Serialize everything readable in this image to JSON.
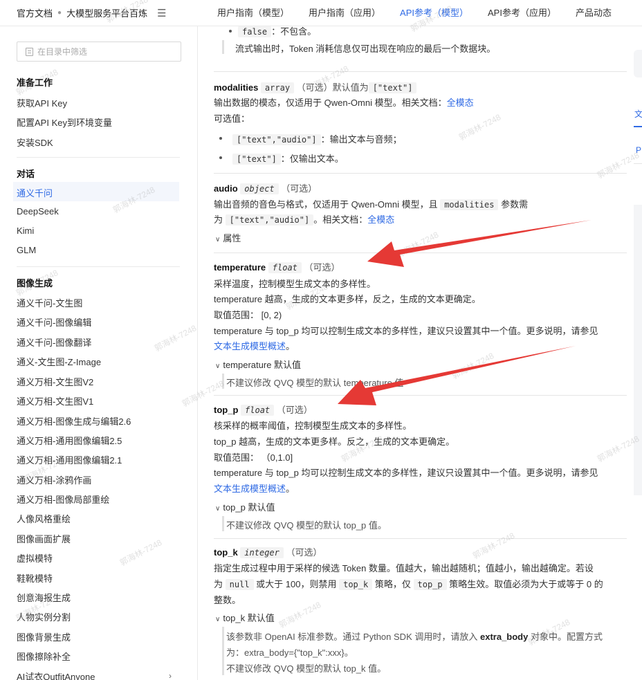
{
  "header": {
    "brand": "官方文档",
    "product": "大模型服务平台百炼",
    "menu_icon": "hamburger-icon",
    "tabs": [
      {
        "label": "用户指南（模型）",
        "active": false
      },
      {
        "label": "用户指南（应用）",
        "active": false
      },
      {
        "label": "API参考（模型）",
        "active": true
      },
      {
        "label": "API参考（应用）",
        "active": false
      },
      {
        "label": "产品动态",
        "active": false
      }
    ]
  },
  "sidebar": {
    "filter_placeholder": "在目录中筛选",
    "groups": [
      {
        "title": "准备工作",
        "items": [
          "获取API Key",
          "配置API Key到环境变量",
          "安装SDK"
        ]
      },
      {
        "title": "对话",
        "items": [
          "通义千问",
          "DeepSeek",
          "Kimi",
          "GLM"
        ],
        "active_item": "通义千问"
      },
      {
        "title": "图像生成",
        "items": [
          "通义千问-文生图",
          "通义千问-图像编辑",
          "通义千问-图像翻译",
          "通义-文生图-Z-Image",
          "通义万相-文生图V2",
          "通义万相-文生图V1",
          "通义万相-图像生成与编辑2.6",
          "通义万相-通用图像编辑2.5",
          "通义万相-通用图像编辑2.1",
          "通义万相-涂鸦作画",
          "通义万相-图像局部重绘",
          "人像风格重绘",
          "图像画面扩展",
          "虚拟模特",
          "鞋靴模特",
          "创意海报生成",
          "人物实例分割",
          "图像背景生成",
          "图像擦除补全",
          "AI试衣OutfitAnyone"
        ]
      }
    ]
  },
  "content": {
    "top": {
      "false_code": "false",
      "false_desc": "：不包含。",
      "note": "流式输出时，Token 消耗信息仅可出现在响应的最后一个数据块。"
    },
    "modalities": {
      "name": "modalities",
      "type": "array",
      "optional": "（可选）默认值为",
      "default_code": "[\"text\"]",
      "desc_prefix": "输出数据的模态，仅适用于 Qwen-Omni 模型。相关文档：",
      "link": "全模态",
      "values_label": "可选值：",
      "values": [
        {
          "code": "[\"text\",\"audio\"]",
          "desc": "：输出文本与音频；"
        },
        {
          "code": "[\"text\"]",
          "desc": "：仅输出文本。"
        }
      ]
    },
    "audio": {
      "name": "audio",
      "type": "object",
      "optional": "（可选）",
      "desc_line1_prefix": "输出音频的音色与格式，仅适用于 Qwen-Omni 模型，且",
      "desc_line1_code": "modalities",
      "desc_line1_suffix": "参数需",
      "desc_line2_prefix": "为",
      "desc_line2_code": "[\"text\",\"audio\"]",
      "desc_line2_mid": "。相关文档：",
      "link": "全模态",
      "expander": "属性"
    },
    "temperature": {
      "name": "temperature",
      "type": "float",
      "optional": "（可选）",
      "line1": "采样温度，控制模型生成文本的多样性。",
      "line2": "temperature 越高，生成的文本更多样，反之，生成的文本更确定。",
      "range": "取值范围： [0, 2)",
      "line4": "temperature 与 top_p 均可以控制生成文本的多样性，建议只设置其中一个值。更多说明，请参见",
      "link": "文本生成模型概述",
      "link_suffix": "。",
      "expander": "temperature 默认值",
      "note": "不建议修改 QVQ 模型的默认 temperature 值"
    },
    "top_p": {
      "name": "top_p",
      "type": "float",
      "optional": "（可选）",
      "line1": "核采样的概率阈值，控制模型生成文本的多样性。",
      "line2": "top_p 越高，生成的文本更多样。反之，生成的文本更确定。",
      "range": "取值范围： （0,1.0]",
      "line4": "temperature 与 top_p 均可以控制生成文本的多样性，建议只设置其中一个值。更多说明，请参见",
      "link": "文本生成模型概述",
      "link_suffix": "。",
      "expander": "top_p 默认值",
      "note": "不建议修改 QVQ 模型的默认 top_p 值。"
    },
    "top_k": {
      "name": "top_k",
      "type": "integer",
      "optional": "（可选）",
      "line1": "指定生成过程中用于采样的候选 Token 数量。值越大，输出越随机；值越小，输出越确定。若设",
      "line2_a": "为",
      "line2_code1": "null",
      "line2_b": "或大于 100，则禁用",
      "line2_code2": "top_k",
      "line2_c": "策略，仅",
      "line2_code3": "top_p",
      "line2_d": "策略生效。取值必须为大于或等于 0 的",
      "line3": "整数。",
      "expander": "top_k 默认值",
      "note1_a": "该参数非 OpenAI 标准参数。通过 Python SDK 调用时，请放入",
      "note1_bold": "extra_body",
      "note1_b": "对象中。配置方式",
      "note2": "为：extra_body={\"top_k\":xxx}。",
      "note3": "不建议修改 QVQ 模型的默认 top_k 值。"
    }
  },
  "right_rail": {
    "label1": "文",
    "label2": "P"
  },
  "watermark": "郭海林-7248",
  "annotation_color": "#e53935"
}
